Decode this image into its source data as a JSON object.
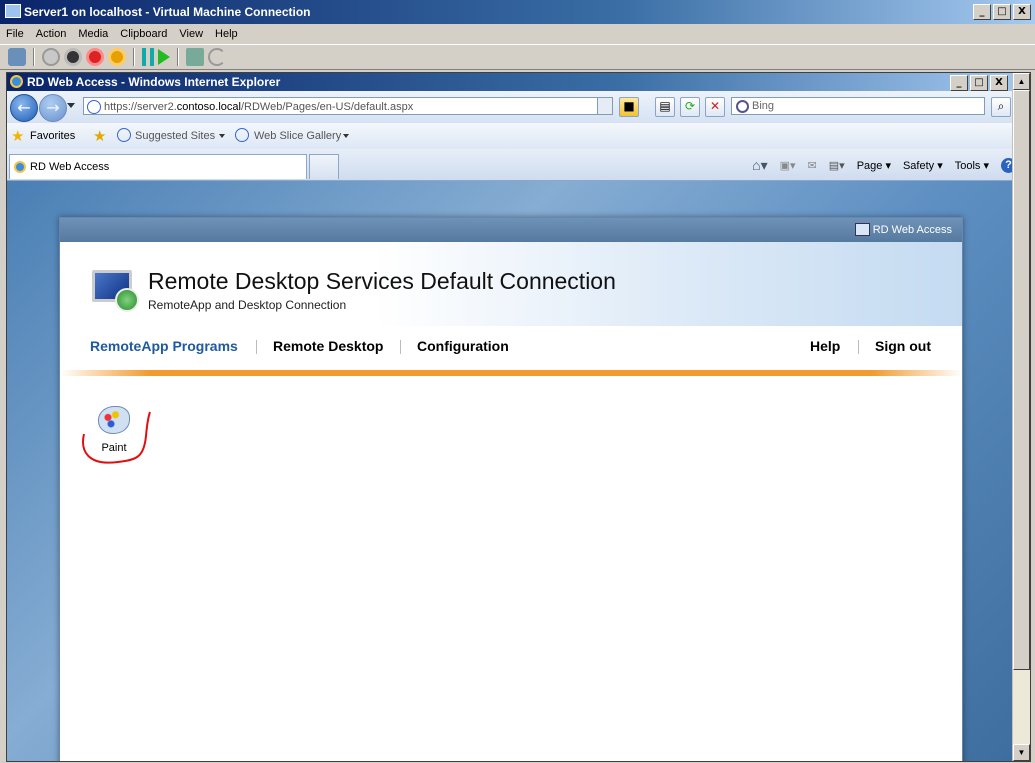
{
  "vm_window": {
    "title": "Server1 on localhost - Virtual Machine Connection",
    "menu": [
      "File",
      "Action",
      "Media",
      "Clipboard",
      "View",
      "Help"
    ],
    "controls": {
      "minimize": "_",
      "maximize": "□",
      "close": "X"
    }
  },
  "ie_window": {
    "title": "RD Web Access - Windows Internet Explorer",
    "address": {
      "prefix": "https://server2.",
      "domain": "contoso.local",
      "path": "/RDWeb/Pages/en-US/default.aspx"
    },
    "search_placeholder": "Bing",
    "favorites": {
      "label": "Favorites",
      "suggested": "Suggested Sites",
      "webslice": "Web Slice Gallery"
    },
    "tab_label": "RD Web Access",
    "commands": {
      "page": "Page",
      "safety": "Safety",
      "tools": "Tools"
    }
  },
  "page": {
    "header_link": "RD Web Access",
    "title": "Remote Desktop Services Default Connection",
    "subtitle": "RemoteApp and Desktop Connection",
    "nav": {
      "remoteapp": "RemoteApp Programs",
      "desktop": "Remote Desktop",
      "config": "Configuration",
      "help": "Help",
      "signout": "Sign out"
    },
    "apps": [
      {
        "name": "Paint"
      }
    ]
  },
  "colors": {
    "accent": "#1f5aa0",
    "orange": "#f29a2e"
  }
}
